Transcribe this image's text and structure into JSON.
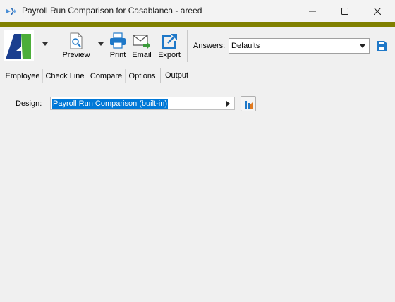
{
  "window": {
    "title": "Payroll Run Comparison for Casablanca - areed"
  },
  "toolbar": {
    "preview_label": "Preview",
    "print_label": "Print",
    "email_label": "Email",
    "export_label": "Export",
    "answers_label": "Answers:",
    "answers_value": "Defaults"
  },
  "tabs": [
    {
      "label": "Employee"
    },
    {
      "label": "Check Line"
    },
    {
      "label": "Compare"
    },
    {
      "label": "Options"
    },
    {
      "label": "Output",
      "active": true
    }
  ],
  "output": {
    "design_label": "Design:",
    "design_value": "Payroll Run Comparison (built-in)"
  },
  "colors": {
    "accent": "#808000",
    "selection": "#0078d7",
    "icon_blue": "#1e78c8",
    "logo_green": "#4cae3a"
  },
  "icons": [
    "app-icon",
    "minimize-icon",
    "maximize-icon",
    "close-icon",
    "logo-icon",
    "preview-icon",
    "print-icon",
    "email-icon",
    "export-icon",
    "save-icon",
    "report-design-icon"
  ]
}
